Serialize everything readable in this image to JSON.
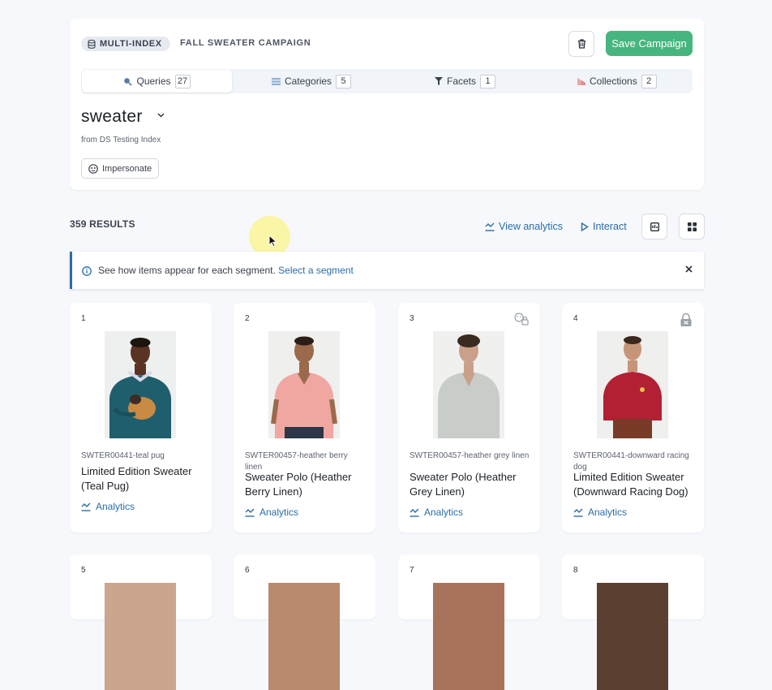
{
  "header": {
    "badge": "MULTI-INDEX",
    "campaign_name": "FALL SWEATER CAMPAIGN",
    "save_label": "Save Campaign"
  },
  "tabs": [
    {
      "label": "Queries",
      "count": "27",
      "icon": "search-icon",
      "active": true
    },
    {
      "label": "Categories",
      "count": "5",
      "icon": "categories-icon",
      "active": false
    },
    {
      "label": "Facets",
      "count": "1",
      "icon": "filter-icon",
      "active": false
    },
    {
      "label": "Collections",
      "count": "2",
      "icon": "collections-icon",
      "active": false
    }
  ],
  "query": {
    "title": "sweater",
    "source": "from DS Testing Index",
    "impersonate_label": "Impersonate"
  },
  "toolbar": {
    "results_count": "359 RESULTS",
    "view_analytics": "View analytics",
    "interact": "Interact"
  },
  "banner": {
    "text": "See how items appear for each segment.",
    "link": "Select a segment"
  },
  "products": [
    {
      "rank": "1",
      "sku": "SWTER00441-teal pug",
      "name": "Limited Edition Sweater (Teal Pug)",
      "analytics": "Analytics",
      "flag": ""
    },
    {
      "rank": "2",
      "sku": "SWTER00457-heather berry linen",
      "name": "Sweater Polo (Heather Berry Linen)",
      "analytics": "Analytics",
      "flag": ""
    },
    {
      "rank": "3",
      "sku": "SWTER00457-heather grey linen",
      "name": "Sweater Polo (Heather Grey Linen)",
      "analytics": "Analytics",
      "flag": "segment-lock-icon"
    },
    {
      "rank": "4",
      "sku": "SWTER00441-downward racing dog",
      "name": "Limited Edition Sweater (Downward Racing Dog)",
      "analytics": "Analytics",
      "flag": "pinned-lock-icon"
    }
  ],
  "next_row_ranks": [
    "5",
    "6",
    "7",
    "8"
  ],
  "colors": {
    "accent": "#2b6da8",
    "save": "#47b57f",
    "background": "#f6f8fb"
  }
}
